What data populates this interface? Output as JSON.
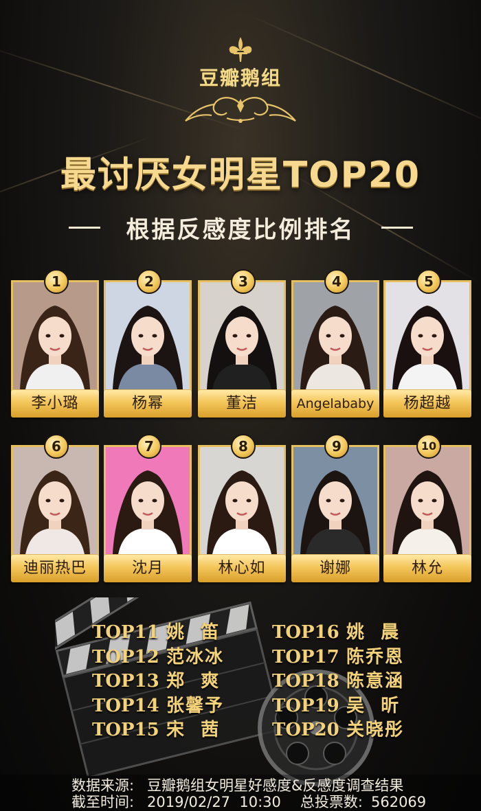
{
  "brand": "豆瓣鹅组",
  "title": "最讨厌女明星TOP20",
  "subtitle": "根据反感度比例排名",
  "top10": [
    {
      "rank": "1",
      "name": "李小璐"
    },
    {
      "rank": "2",
      "name": "杨幂"
    },
    {
      "rank": "3",
      "name": "董洁"
    },
    {
      "rank": "4",
      "name": "Angelababy"
    },
    {
      "rank": "5",
      "name": "杨超越"
    },
    {
      "rank": "6",
      "name": "迪丽热巴"
    },
    {
      "rank": "7",
      "name": "沈月"
    },
    {
      "rank": "8",
      "name": "林心如"
    },
    {
      "rank": "9",
      "name": "谢娜"
    },
    {
      "rank": "10",
      "name": "林允"
    }
  ],
  "ranks_left": [
    {
      "tag": "TOP11",
      "name": "姚  笛"
    },
    {
      "tag": "TOP12",
      "name": "范冰冰"
    },
    {
      "tag": "TOP13",
      "name": "郑  爽"
    },
    {
      "tag": "TOP14",
      "name": "张馨予"
    },
    {
      "tag": "TOP15",
      "name": "宋  茜"
    }
  ],
  "ranks_right": [
    {
      "tag": "TOP16",
      "name": "姚  晨"
    },
    {
      "tag": "TOP17",
      "name": "陈乔恩"
    },
    {
      "tag": "TOP18",
      "name": "陈意涵"
    },
    {
      "tag": "TOP19",
      "name": "吴  昕"
    },
    {
      "tag": "TOP20",
      "name": "关晓彤"
    }
  ],
  "footer": {
    "source_label": "数据来源:",
    "source_value": "豆瓣鹅组女明星好感度&反感度调查结果",
    "time_label": "截至时间:",
    "time_value": "2019/02/27  10:30",
    "votes_label": "总投票数:",
    "votes_value": "562069"
  },
  "colors": {
    "gold": "#f6d98e",
    "plate": "#f4c65a",
    "photo_bgs": [
      "#b89a8a",
      "#cfd6e3",
      "#d8d2cc",
      "#9fa3a8",
      "#e4e1e6",
      "#c9b7b2",
      "#f07ab9",
      "#d7d6d2",
      "#7d8fa3",
      "#c9a9a2"
    ],
    "hair": [
      "#3a2418",
      "#1c1412",
      "#141010",
      "#2a1c14",
      "#1a1010",
      "#3b2516",
      "#2b1a12",
      "#2a1a12",
      "#1c1410",
      "#201410"
    ],
    "tops": [
      "#f0f0f0",
      "#7b8aa3",
      "#202020",
      "#ece7e1",
      "#f4f4f4",
      "#efe8e4",
      "#ffffff",
      "#ffffff",
      "#2a2a2a",
      "#f5f0ea"
    ]
  }
}
